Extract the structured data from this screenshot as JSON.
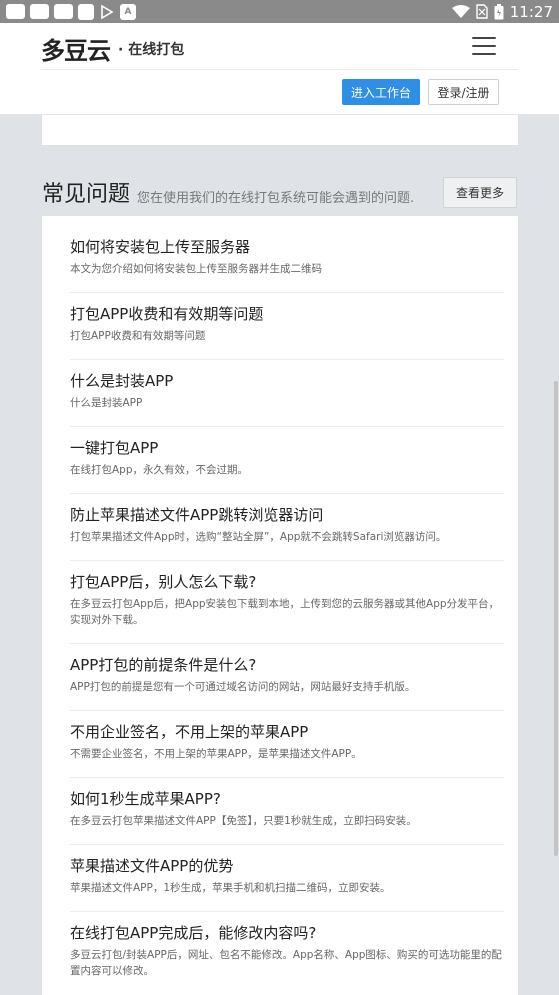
{
  "status_bar": {
    "icons": [
      "app-icon-1",
      "app-icon-2",
      "app-icon-3",
      "app-icon-4",
      "play-store-icon",
      "app-icon-a"
    ],
    "icon_labels": [
      "",
      "",
      "",
      "",
      "",
      "A"
    ],
    "time": "11:27"
  },
  "header": {
    "logo_mark": "多豆云",
    "logo_sub": "· 在线打包",
    "workbench_label": "进入工作台",
    "login_label": "登录/注册"
  },
  "faq": {
    "title": "常见问题",
    "description": "您在使用我们的在线打包系统可能会遇到的问题.",
    "more_label": "查看更多",
    "items": [
      {
        "question": "如何将安装包上传至服务器",
        "answer": "本文为您介绍如何将安装包上传至服务器并生成二维码"
      },
      {
        "question": "打包APP收费和有效期等问题",
        "answer": "打包APP收费和有效期等问题"
      },
      {
        "question": "什么是封装APP",
        "answer": "什么是封装APP"
      },
      {
        "question": "一键打包APP",
        "answer": "在线打包App，永久有效，不会过期。"
      },
      {
        "question": "防止苹果描述文件APP跳转浏览器访问",
        "answer": "打包苹果描述文件App时，选购“整站全屏”，App就不会跳转Safari浏览器访问。"
      },
      {
        "question": "打包APP后，别人怎么下载?",
        "answer": "在多豆云打包App后，把App安装包下载到本地，上传到您的云服务器或其他App分发平台，实现对外下载。"
      },
      {
        "question": "APP打包的前提条件是什么?",
        "answer": "APP打包的前提是您有一个可通过域名访问的网站，网站最好支持手机版。"
      },
      {
        "question": "不用企业签名，不用上架的苹果APP",
        "answer": "不需要企业签名，不用上架的苹果APP，是苹果描述文件APP。"
      },
      {
        "question": "如何1秒生成苹果APP?",
        "answer": "在多豆云打包苹果描述文件APP【免签】，只要1秒就生成，立即扫码安装。"
      },
      {
        "question": "苹果描述文件APP的优势",
        "answer": "苹果描述文件APP，1秒生成，苹果手机和机扫描二维码，立即安装。"
      },
      {
        "question": "在线打包APP完成后，能修改内容吗?",
        "answer": "多豆云打包/封装APP后，网址、包名不能修改。App名称、App图标、购买的可选功能里的配置内容可以修改。"
      }
    ]
  }
}
